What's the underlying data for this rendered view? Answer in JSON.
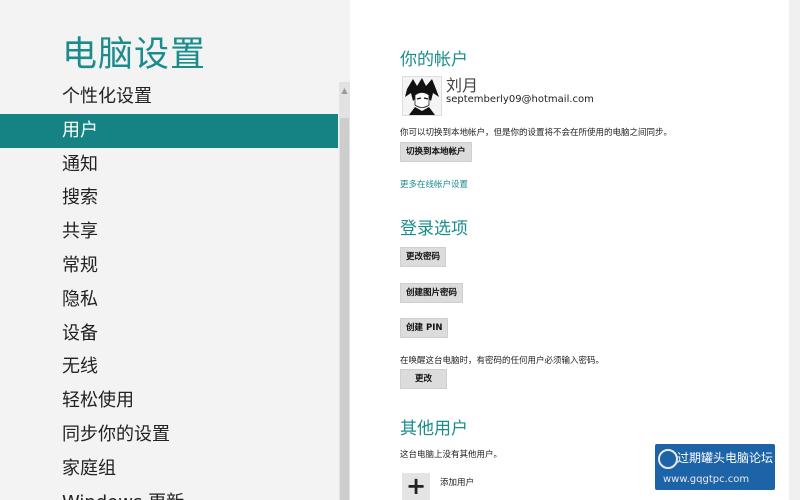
{
  "nav": {
    "title": "电脑设置",
    "items": [
      {
        "label": "个性化设置"
      },
      {
        "label": "用户",
        "selected": true
      },
      {
        "label": "通知"
      },
      {
        "label": "搜索"
      },
      {
        "label": "共享"
      },
      {
        "label": "常规"
      },
      {
        "label": "隐私"
      },
      {
        "label": "设备"
      },
      {
        "label": "无线"
      },
      {
        "label": "轻松使用"
      },
      {
        "label": "同步你的设置"
      },
      {
        "label": "家庭组"
      },
      {
        "label": "Windows 更新"
      }
    ]
  },
  "account": {
    "heading": "你的帐户",
    "name": "刘月",
    "email": "septemberly09@hotmail.com",
    "sync_note": "你可以切换到本地帐户，但是你的设置将不会在所使用的电脑之间同步。",
    "switch_button": "切换到本地帐户",
    "more_link": "更多在线帐户设置"
  },
  "signin": {
    "heading": "登录选项",
    "change_password": "更改密码",
    "create_picture_password": "创建图片密码",
    "create_pin": "创建 PIN",
    "wake_note": "在唤醒这台电脑时，有密码的任何用户必须输入密码。",
    "change_button": "更改"
  },
  "other_users": {
    "heading": "其他用户",
    "note": "这台电脑上没有其他用户。",
    "add_label": "添加用户"
  },
  "watermark": {
    "text": "过期罐头电脑论坛",
    "site": "www.gqgtpc.com"
  },
  "colors": {
    "accent": "#1b8c8c",
    "selected_bg": "#158383"
  }
}
